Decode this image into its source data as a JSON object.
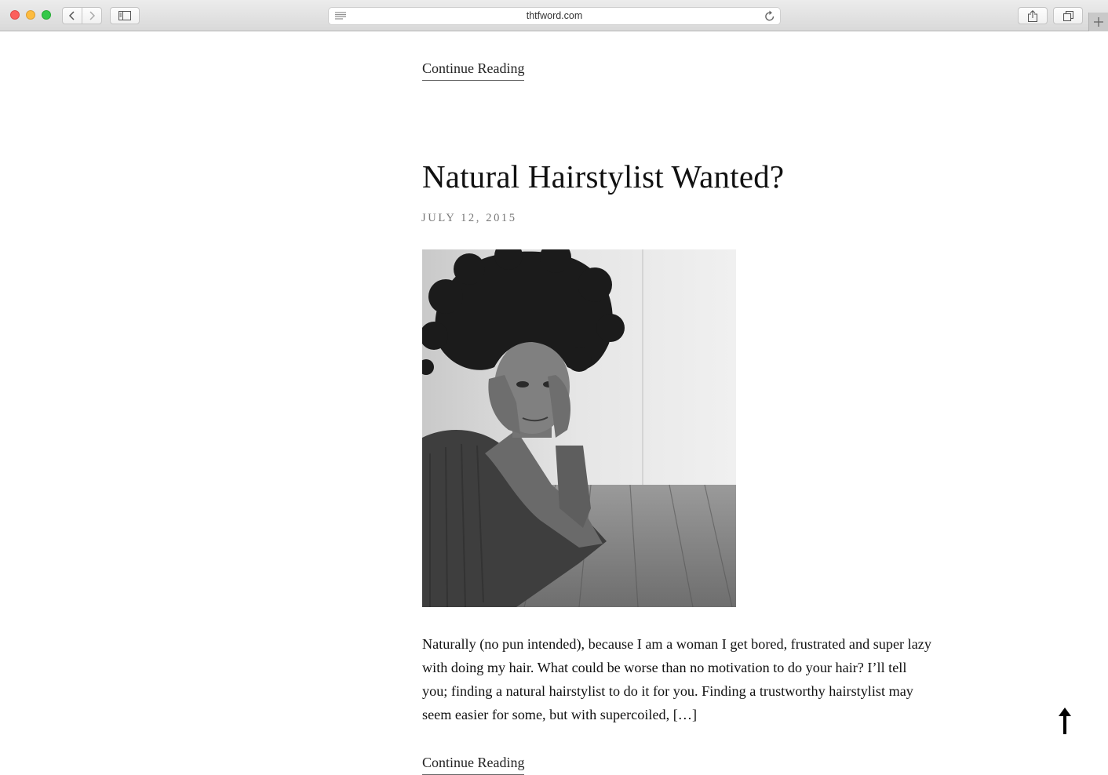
{
  "browser": {
    "url": "thtfword.com",
    "buttons": {
      "back": "back",
      "forward": "forward",
      "sidebar": "sidebar",
      "share": "share",
      "tabs": "tabs",
      "new_tab": "new-tab"
    }
  },
  "page": {
    "previous_post": {
      "read_more": "Continue Reading"
    },
    "post": {
      "title": "Natural Hairstylist Wanted?",
      "date": "JULY 12, 2015",
      "excerpt": "Naturally (no pun intended), because I am a woman I get bored, frustrated and super lazy with doing my hair. What could be worse than no motivation to do your hair? I’ll tell you; finding a natural hairstylist to do it for you. Finding a trustworthy hairstylist may seem easier for some, but with supercoiled, […]",
      "read_more": "Continue Reading"
    },
    "back_to_top_icon": "arrow-up-icon"
  }
}
